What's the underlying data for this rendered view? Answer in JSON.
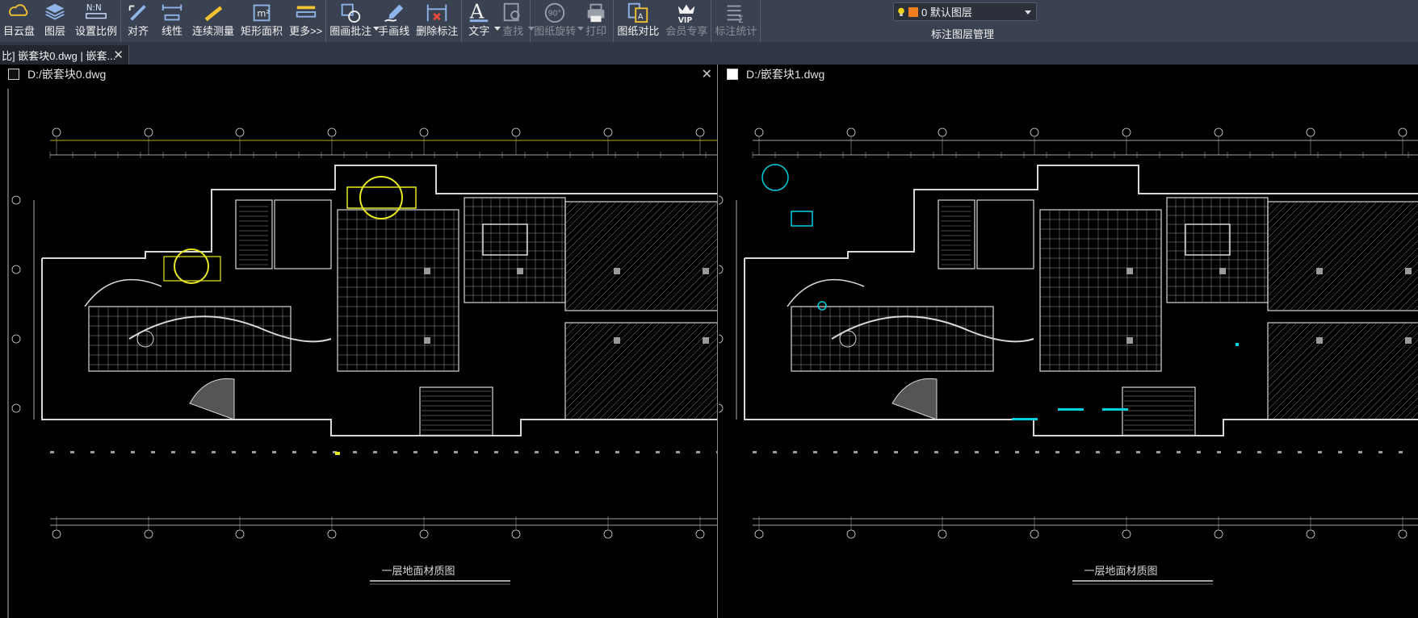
{
  "toolbar": {
    "groups": [
      [
        {
          "label": "目云盘",
          "icon": "cloud-icon"
        },
        {
          "label": "图层",
          "icon": "layers-icon"
        },
        {
          "label": "设置比例",
          "icon": "scale-icon"
        }
      ],
      [
        {
          "label": "对齐",
          "icon": "align-icon"
        },
        {
          "label": "线性",
          "icon": "linear-dim-icon"
        },
        {
          "label": "连续测量",
          "icon": "ruler-icon"
        },
        {
          "label": "矩形面积",
          "icon": "area-icon"
        },
        {
          "label": "更多>>",
          "icon": "more-icon"
        }
      ],
      [
        {
          "label": "圈画批注",
          "icon": "markup-icon",
          "dropdown": true
        },
        {
          "label": "手画线",
          "icon": "pen-icon"
        },
        {
          "label": "删除标注",
          "icon": "delete-dim-icon"
        }
      ],
      [
        {
          "label": "文字",
          "icon": "text-icon",
          "dropdown": true
        },
        {
          "label": "查找",
          "icon": "find-icon",
          "dropdown": true,
          "disabled": true
        }
      ],
      [
        {
          "label": "图纸旋转",
          "icon": "rotate-icon",
          "dropdown": true,
          "disabled": true
        },
        {
          "label": "打印",
          "icon": "print-icon",
          "disabled": true
        }
      ],
      [
        {
          "label": "图纸对比",
          "icon": "compare-icon"
        },
        {
          "label": "会员专享",
          "icon": "vip-icon",
          "disabled": true
        }
      ],
      [
        {
          "label": "标注统计",
          "icon": "stats-icon",
          "disabled": true
        }
      ]
    ],
    "layer_select": {
      "value": "0 默认图层",
      "color": "#f07d1e"
    },
    "layer_manage_label": "标注图层管理"
  },
  "tab": {
    "title": "比] 嵌套块0.dwg | 嵌套..."
  },
  "left_pane": {
    "path": "D:/嵌套块0.dwg",
    "title": "一层地面材质图"
  },
  "right_pane": {
    "path": "D:/嵌套块1.dwg",
    "title": "一层地面材质图"
  },
  "colors": {
    "accent_yellow": "#e8e81e",
    "accent_cyan": "#00d0e0",
    "toolbar_bg": "#3a4150"
  }
}
